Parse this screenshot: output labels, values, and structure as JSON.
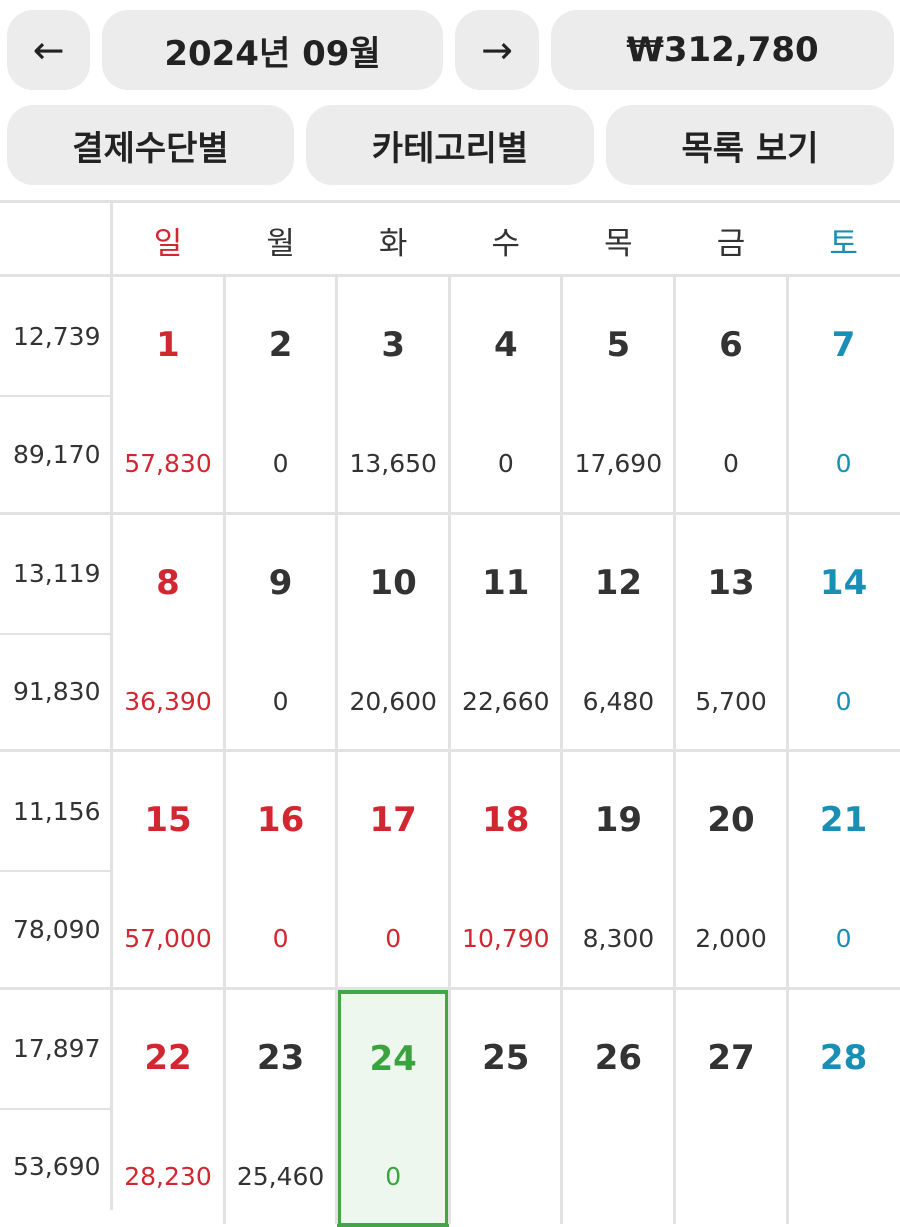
{
  "header": {
    "prev_label": "←",
    "month_label": "2024년 09월",
    "next_label": "→",
    "total_label": "₩312,780"
  },
  "views": {
    "by_payment": "결제수단별",
    "by_category": "카테고리별",
    "list_view": "목록 보기"
  },
  "weekdays": [
    "일",
    "월",
    "화",
    "수",
    "목",
    "금",
    "토"
  ],
  "weeks": [
    {
      "avg": "12,739",
      "total": "89,170",
      "days": [
        {
          "day": "1",
          "amount": "57,830",
          "color": "red"
        },
        {
          "day": "2",
          "amount": "0",
          "color": "normal"
        },
        {
          "day": "3",
          "amount": "13,650",
          "color": "normal"
        },
        {
          "day": "4",
          "amount": "0",
          "color": "normal"
        },
        {
          "day": "5",
          "amount": "17,690",
          "color": "normal"
        },
        {
          "day": "6",
          "amount": "0",
          "color": "normal"
        },
        {
          "day": "7",
          "amount": "0",
          "color": "blue"
        }
      ]
    },
    {
      "avg": "13,119",
      "total": "91,830",
      "days": [
        {
          "day": "8",
          "amount": "36,390",
          "color": "red"
        },
        {
          "day": "9",
          "amount": "0",
          "color": "normal"
        },
        {
          "day": "10",
          "amount": "20,600",
          "color": "normal"
        },
        {
          "day": "11",
          "amount": "22,660",
          "color": "normal"
        },
        {
          "day": "12",
          "amount": "6,480",
          "color": "normal"
        },
        {
          "day": "13",
          "amount": "5,700",
          "color": "normal"
        },
        {
          "day": "14",
          "amount": "0",
          "color": "blue"
        }
      ]
    },
    {
      "avg": "11,156",
      "total": "78,090",
      "days": [
        {
          "day": "15",
          "amount": "57,000",
          "color": "red"
        },
        {
          "day": "16",
          "amount": "0",
          "color": "red"
        },
        {
          "day": "17",
          "amount": "0",
          "color": "red"
        },
        {
          "day": "18",
          "amount": "10,790",
          "color": "red"
        },
        {
          "day": "19",
          "amount": "8,300",
          "color": "normal"
        },
        {
          "day": "20",
          "amount": "2,000",
          "color": "normal"
        },
        {
          "day": "21",
          "amount": "0",
          "color": "blue"
        }
      ]
    },
    {
      "avg": "17,897",
      "total": "53,690",
      "days": [
        {
          "day": "22",
          "amount": "28,230",
          "color": "red"
        },
        {
          "day": "23",
          "amount": "25,460",
          "color": "normal"
        },
        {
          "day": "24",
          "amount": "0",
          "color": "green",
          "today": true
        },
        {
          "day": "25",
          "amount": "",
          "color": "normal"
        },
        {
          "day": "26",
          "amount": "",
          "color": "normal"
        },
        {
          "day": "27",
          "amount": "",
          "color": "normal"
        },
        {
          "day": "28",
          "amount": "",
          "color": "blue"
        }
      ]
    }
  ],
  "colors": {
    "holiday_red": "#d22730",
    "saturday_blue": "#1a8fb5",
    "today_green": "#3aa33f",
    "button_bg": "#ececec"
  }
}
